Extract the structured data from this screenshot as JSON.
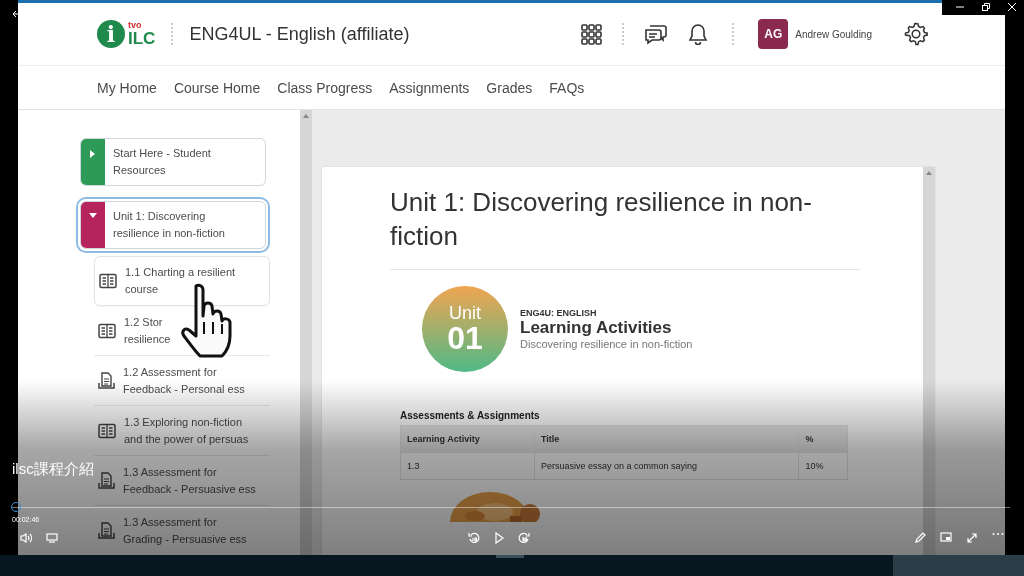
{
  "player": {
    "title": "ilsc課程介紹",
    "time": "00:02:46",
    "level": 0
  },
  "lms": {
    "logo": {
      "mark": "i",
      "brand_small": "tvo",
      "brand": "ILC"
    },
    "course_title": "ENG4UL - English (affiliate)",
    "user": {
      "initials": "AG",
      "name": "Andrew Goulding"
    },
    "nav": [
      "My Home",
      "Course Home",
      "Class Progress",
      "Assignments",
      "Grades",
      "FAQs"
    ],
    "modules": [
      {
        "lines": [
          "Start Here - Student",
          "Resources"
        ],
        "color": "#2e9a57",
        "expanded": false,
        "focused": false
      },
      {
        "lines": [
          "Unit 1: Discovering",
          "resilience in non-fiction"
        ],
        "color": "#b5245a",
        "expanded": true,
        "focused": true,
        "children": [
          {
            "kind": "reading",
            "lines": [
              "1.1 Charting a resilient",
              "course"
            ],
            "selected": true
          },
          {
            "kind": "reading",
            "lines": [
              "1.2 Stor",
              "resilience"
            ],
            "selected": false
          },
          {
            "kind": "assignment",
            "lines": [
              "1.2 Assessment for",
              "Feedback - Personal ess"
            ],
            "selected": false
          },
          {
            "kind": "reading",
            "lines": [
              "1.3 Exploring non-fiction",
              "and the power of persuas"
            ],
            "selected": false
          },
          {
            "kind": "assignment",
            "lines": [
              "1.3 Assessment for",
              "Feedback - Persuasive ess"
            ],
            "selected": false
          },
          {
            "kind": "assignment",
            "lines": [
              "1.3 Assessment for",
              "Grading - Persuasive ess"
            ],
            "selected": false
          }
        ]
      }
    ],
    "content": {
      "title": "Unit 1: Discovering resilience in non-fiction",
      "badge": {
        "word": "Unit",
        "number": "01"
      },
      "course_code": "ENG4U: ENGLISH",
      "heading": "Learning Activities",
      "subtitle": "Discovering resilience in non-fiction",
      "table_caption": "Assessments & Assignments",
      "table": {
        "columns": [
          "Learning Activity",
          "Title",
          "%"
        ],
        "rows": [
          [
            "1.3",
            "Persuasive essay on a common saying",
            "10%"
          ]
        ]
      }
    }
  }
}
